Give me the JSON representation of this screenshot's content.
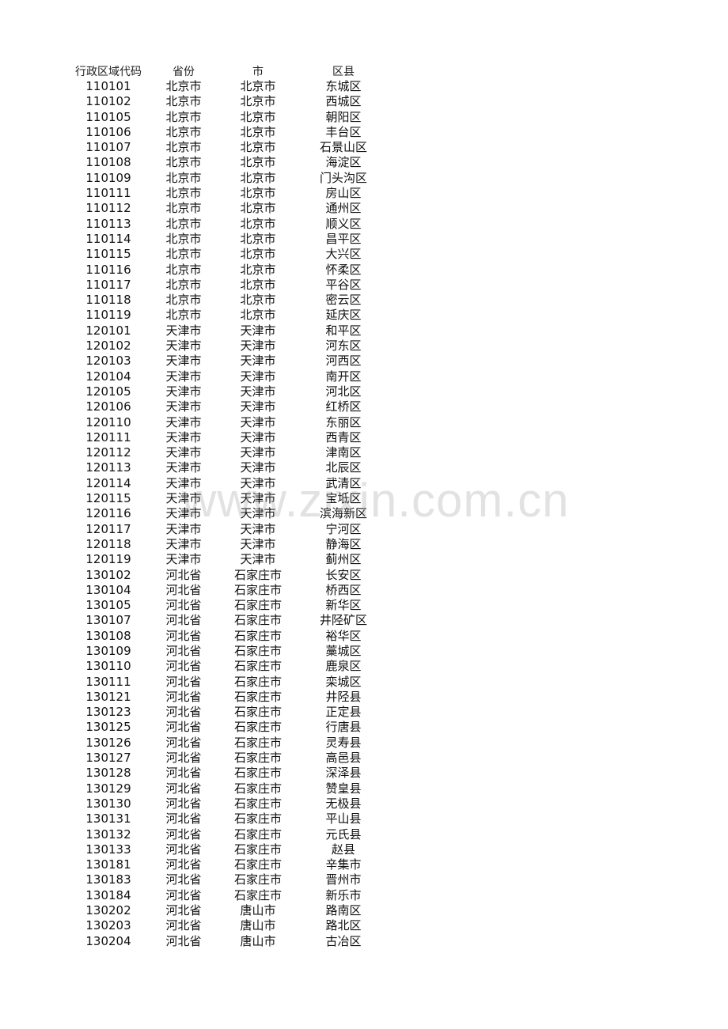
{
  "table": {
    "headers": [
      "行政区域代码",
      "省份",
      "市",
      "区县"
    ],
    "rows": [
      [
        "110101",
        "北京市",
        "北京市",
        "东城区"
      ],
      [
        "110102",
        "北京市",
        "北京市",
        "西城区"
      ],
      [
        "110105",
        "北京市",
        "北京市",
        "朝阳区"
      ],
      [
        "110106",
        "北京市",
        "北京市",
        "丰台区"
      ],
      [
        "110107",
        "北京市",
        "北京市",
        "石景山区"
      ],
      [
        "110108",
        "北京市",
        "北京市",
        "海淀区"
      ],
      [
        "110109",
        "北京市",
        "北京市",
        "门头沟区"
      ],
      [
        "110111",
        "北京市",
        "北京市",
        "房山区"
      ],
      [
        "110112",
        "北京市",
        "北京市",
        "通州区"
      ],
      [
        "110113",
        "北京市",
        "北京市",
        "顺义区"
      ],
      [
        "110114",
        "北京市",
        "北京市",
        "昌平区"
      ],
      [
        "110115",
        "北京市",
        "北京市",
        "大兴区"
      ],
      [
        "110116",
        "北京市",
        "北京市",
        "怀柔区"
      ],
      [
        "110117",
        "北京市",
        "北京市",
        "平谷区"
      ],
      [
        "110118",
        "北京市",
        "北京市",
        "密云区"
      ],
      [
        "110119",
        "北京市",
        "北京市",
        "延庆区"
      ],
      [
        "120101",
        "天津市",
        "天津市",
        "和平区"
      ],
      [
        "120102",
        "天津市",
        "天津市",
        "河东区"
      ],
      [
        "120103",
        "天津市",
        "天津市",
        "河西区"
      ],
      [
        "120104",
        "天津市",
        "天津市",
        "南开区"
      ],
      [
        "120105",
        "天津市",
        "天津市",
        "河北区"
      ],
      [
        "120106",
        "天津市",
        "天津市",
        "红桥区"
      ],
      [
        "120110",
        "天津市",
        "天津市",
        "东丽区"
      ],
      [
        "120111",
        "天津市",
        "天津市",
        "西青区"
      ],
      [
        "120112",
        "天津市",
        "天津市",
        "津南区"
      ],
      [
        "120113",
        "天津市",
        "天津市",
        "北辰区"
      ],
      [
        "120114",
        "天津市",
        "天津市",
        "武清区"
      ],
      [
        "120115",
        "天津市",
        "天津市",
        "宝坻区"
      ],
      [
        "120116",
        "天津市",
        "天津市",
        "滨海新区"
      ],
      [
        "120117",
        "天津市",
        "天津市",
        "宁河区"
      ],
      [
        "120118",
        "天津市",
        "天津市",
        "静海区"
      ],
      [
        "120119",
        "天津市",
        "天津市",
        "蓟州区"
      ],
      [
        "130102",
        "河北省",
        "石家庄市",
        "长安区"
      ],
      [
        "130104",
        "河北省",
        "石家庄市",
        "桥西区"
      ],
      [
        "130105",
        "河北省",
        "石家庄市",
        "新华区"
      ],
      [
        "130107",
        "河北省",
        "石家庄市",
        "井陉矿区"
      ],
      [
        "130108",
        "河北省",
        "石家庄市",
        "裕华区"
      ],
      [
        "130109",
        "河北省",
        "石家庄市",
        "藁城区"
      ],
      [
        "130110",
        "河北省",
        "石家庄市",
        "鹿泉区"
      ],
      [
        "130111",
        "河北省",
        "石家庄市",
        "栾城区"
      ],
      [
        "130121",
        "河北省",
        "石家庄市",
        "井陉县"
      ],
      [
        "130123",
        "河北省",
        "石家庄市",
        "正定县"
      ],
      [
        "130125",
        "河北省",
        "石家庄市",
        "行唐县"
      ],
      [
        "130126",
        "河北省",
        "石家庄市",
        "灵寿县"
      ],
      [
        "130127",
        "河北省",
        "石家庄市",
        "高邑县"
      ],
      [
        "130128",
        "河北省",
        "石家庄市",
        "深泽县"
      ],
      [
        "130129",
        "河北省",
        "石家庄市",
        "赞皇县"
      ],
      [
        "130130",
        "河北省",
        "石家庄市",
        "无极县"
      ],
      [
        "130131",
        "河北省",
        "石家庄市",
        "平山县"
      ],
      [
        "130132",
        "河北省",
        "石家庄市",
        "元氏县"
      ],
      [
        "130133",
        "河北省",
        "石家庄市",
        "赵县"
      ],
      [
        "130181",
        "河北省",
        "石家庄市",
        "辛集市"
      ],
      [
        "130183",
        "河北省",
        "石家庄市",
        "晋州市"
      ],
      [
        "130184",
        "河北省",
        "石家庄市",
        "新乐市"
      ],
      [
        "130202",
        "河北省",
        "唐山市",
        "路南区"
      ],
      [
        "130203",
        "河北省",
        "唐山市",
        "路北区"
      ],
      [
        "130204",
        "河北省",
        "唐山市",
        "古冶区"
      ]
    ]
  },
  "watermark": "www.zixin.com.cn"
}
